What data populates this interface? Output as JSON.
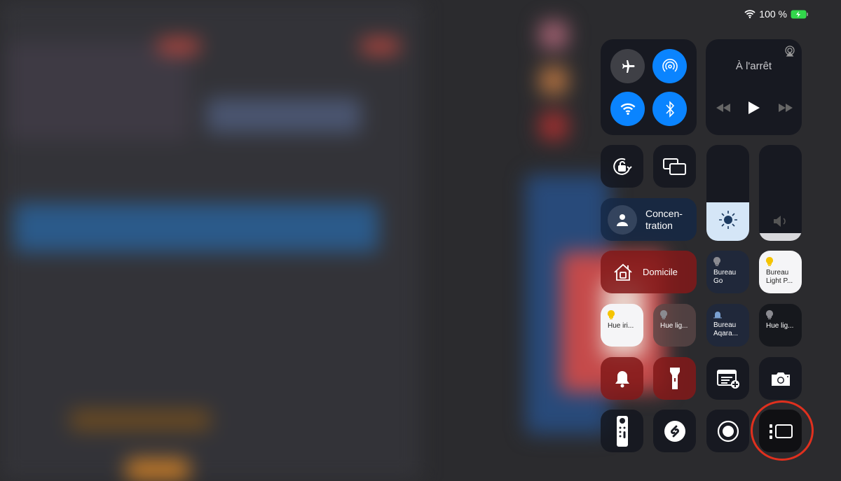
{
  "status": {
    "wifi_icon": "wifi-icon",
    "battery_text": "100 %",
    "battery_icon": "battery-charging-icon",
    "battery_color": "#32d74b"
  },
  "connectivity": {
    "airplane": false,
    "airdrop": true,
    "wifi": true,
    "bluetooth": true,
    "accent": "#0a84ff"
  },
  "media": {
    "title": "À l'arrêt",
    "airplay_icon": "airplay-icon"
  },
  "focus": {
    "label_line1": "Concen-",
    "label_line2": "tration"
  },
  "brightness": {
    "level_percent": 40
  },
  "volume": {
    "level_percent": 8
  },
  "home": {
    "label": "Domicile"
  },
  "accessories": [
    {
      "line1": "Bureau",
      "line2": "Go",
      "on": false
    },
    {
      "line1": "Bureau",
      "line2": "Light P...",
      "on": true
    },
    {
      "line1": "Hue iri...",
      "line2": "",
      "on": true
    },
    {
      "line1": "Hue lig...",
      "line2": "",
      "on": false
    },
    {
      "line1": "Bureau",
      "line2": "Aqara...",
      "on": false
    },
    {
      "line1": "Hue lig...",
      "line2": "",
      "on": false
    }
  ],
  "highlight_color": "#e0301e"
}
